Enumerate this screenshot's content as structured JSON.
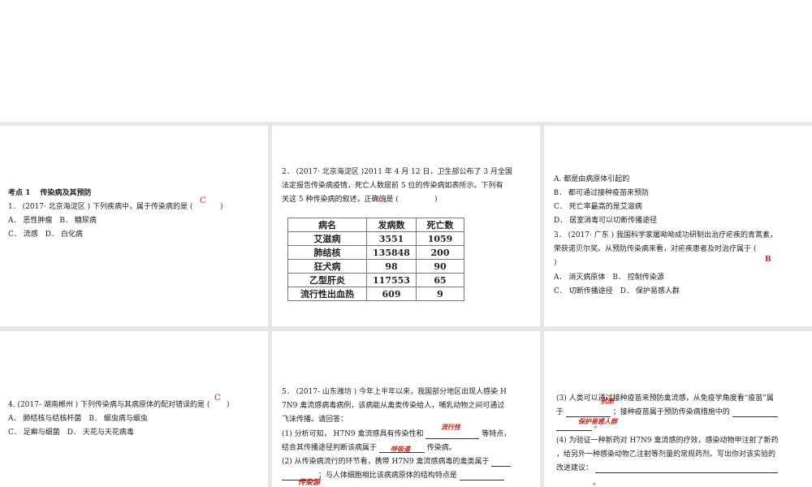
{
  "p1": {
    "heading": "考点 1　 传染病及其预防",
    "q1": "1． (2017· 北京海淀区 ) 下列疾病中，属于传染病的是 (",
    "close": ")",
    "answer": "C",
    "optAB": "A． 恶性肿瘤　B． 糖尿病",
    "optCD": "C． 流感　D． 白化病"
  },
  "p2": {
    "line1": "2． (2017· 北京海淀区 )2011 年 4 月 12 日，卫生部公布了 3 月全国",
    "line2": "法定报告传染病疫情，死亡人数居前 5 位的传染病如表所示。下列有",
    "line3": "关这 5 种传染病的叙述，正确的是 (",
    "close": ")",
    "answer": "A",
    "table": {
      "headers": [
        "病名",
        "发病数",
        "死亡数"
      ],
      "rows": [
        [
          "艾滋病",
          "3551",
          "1059"
        ],
        [
          "肺结核",
          "135848",
          "200"
        ],
        [
          "狂犬病",
          "98",
          "90"
        ],
        [
          "乙型肝炎",
          "117553",
          "65"
        ],
        [
          "流行性出血热",
          "609",
          "9"
        ]
      ]
    }
  },
  "p3": {
    "optA": "A. 都是由病原体引起的",
    "optB": "B． 都可通过接种疫苗来预防",
    "optC": "C． 死亡率最高的是艾滋病",
    "optD": "D． 居室消毒可以切断传播途径",
    "q3l1": "3． (2017· 广东 ) 我国科学家屠呦呦成功研制出治疗疟疾的青蒿素，",
    "q3l2": "荣获诺贝尔奖。从预防传染病来看，对疟疾患者及时治疗属于 (",
    "q3l3": ")",
    "answer": "B",
    "optAB": "A． 消灭病原体　B． 控制传染源",
    "optCD": "C． 切断传播途径　D． 保护易感人群"
  },
  "p4": {
    "q4": "4. (2017- 湖南郴州 ) 下列传染病与其病原体的配对错误的是 (",
    "close": ")",
    "answer": "C",
    "optAB": "A． 肺结核与结核杆菌　B． 蛔虫病与蛔虫",
    "optCD": "C． 足癣与细菌　D． 天花与天花病毒"
  },
  "p5": {
    "l1": "5． (2017- 山东潍坊 ) 今年上半年以来，我国部分地区出现人感染 H",
    "l2": "7N9 禽流感病毒病例，该病能从禽类传染给人，哺乳动物之间可通过",
    "l3": "飞沫传播。请回答：",
    "l4a": "(1) 分析可知， H7N9 禽流感具有传染性和",
    "l4b": "等特点，",
    "l5a": "结合其传播途径判断该病属于",
    "l5b": "传染病。",
    "l6": "(2) 从传染病流行的环节看，携带 H7N9 禽流感病毒的禽类属于",
    "l7": "；与人体细胞相比该病病原体的结构特点是",
    "ans1": "流行性",
    "ans2": "呼吸道",
    "ans3": "传染源"
  },
  "p6": {
    "l1": "(3) 人类可以通过接种疫苗来预防禽流感，从免疫学角度看“疫苗”属",
    "l2a": "于",
    "l2b": "；接种疫苗属于预防传染病措施中的",
    "l3": "。",
    "l4": "(4) 为验证一种新药对 H7N9 禽流感的疗效，感染动物甲注射了新药",
    "l5": "，给另外一种感染动物乙注射等剂量的常规药剂。写出你对该实验的",
    "l6": "改进建议：",
    "l7": "。",
    "ans1": "抗原",
    "ans2": "保护易感人群"
  }
}
